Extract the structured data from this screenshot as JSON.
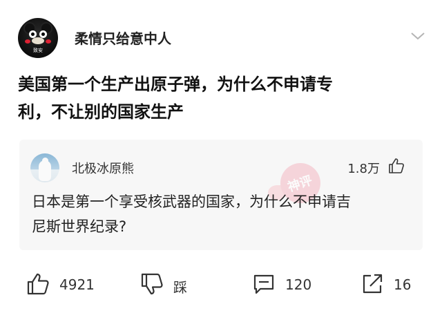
{
  "post": {
    "author": "柔情只给意中人",
    "avatar_tag": "致安",
    "title_line1": "美国第一个生产出原子弹，为什么不申请专",
    "title_line2": "利，不让别的国家生产"
  },
  "quote": {
    "author": "北极冰原熊",
    "likes": "1.8万",
    "text_line1": "日本是第一个享受核武器的国家，为什么不申请吉",
    "text_line2": "尼斯世界纪录?",
    "watermark": "神评"
  },
  "actions": {
    "like_count": "4921",
    "dislike_label": "踩",
    "comment_count": "120",
    "share_count": "16"
  },
  "icons": {
    "menu": "chevron-down-icon",
    "quote_like": "thumbs-up-icon",
    "like": "thumbs-up-icon",
    "dislike": "thumbs-down-icon",
    "comment": "comment-icon",
    "share": "share-icon"
  }
}
